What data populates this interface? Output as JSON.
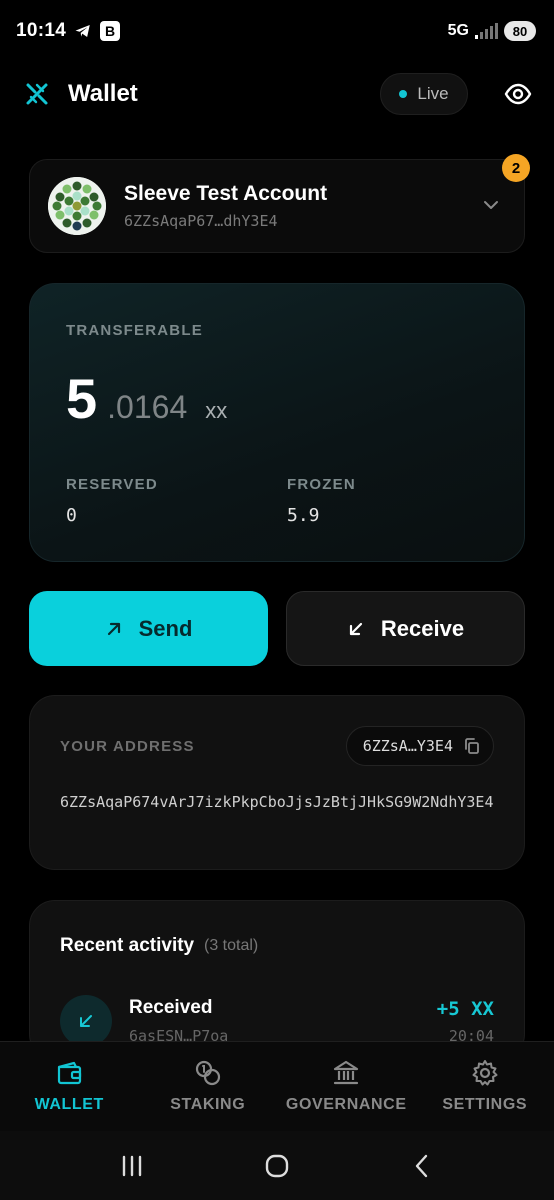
{
  "status_bar": {
    "time": "10:14",
    "b_badge": "B",
    "network": "5G",
    "battery": "80"
  },
  "header": {
    "title": "Wallet",
    "live_label": "Live"
  },
  "account": {
    "name": "Sleeve Test Account",
    "address_short": "6ZZsAqaP67…dhY3E4",
    "badge_count": "2"
  },
  "balance": {
    "transferable_label": "TRANSFERABLE",
    "integer": "5",
    "decimal": ".0164",
    "unit": "xx",
    "reserved_label": "RESERVED",
    "reserved_value": "0",
    "frozen_label": "FROZEN",
    "frozen_value": "5.9"
  },
  "actions": {
    "send_label": "Send",
    "receive_label": "Receive"
  },
  "address": {
    "label": "YOUR ADDRESS",
    "chip": "6ZZsA…Y3E4",
    "full": "6ZZsAqaP674vArJ7izkPkpCboJjsJzBtjJHkSG9W2NdhY3E4"
  },
  "activity": {
    "title": "Recent activity",
    "count": "(3 total)",
    "items": [
      {
        "type": "Received",
        "from": "6asESN…P7oa",
        "amount": "+5 XX",
        "time": "20:04"
      }
    ]
  },
  "nav": {
    "items": [
      {
        "label": "WALLET"
      },
      {
        "label": "STAKING"
      },
      {
        "label": "GOVERNANCE"
      },
      {
        "label": "SETTINGS"
      }
    ]
  },
  "colors": {
    "accent": "#0ad0dc",
    "badge": "#f5a524"
  }
}
